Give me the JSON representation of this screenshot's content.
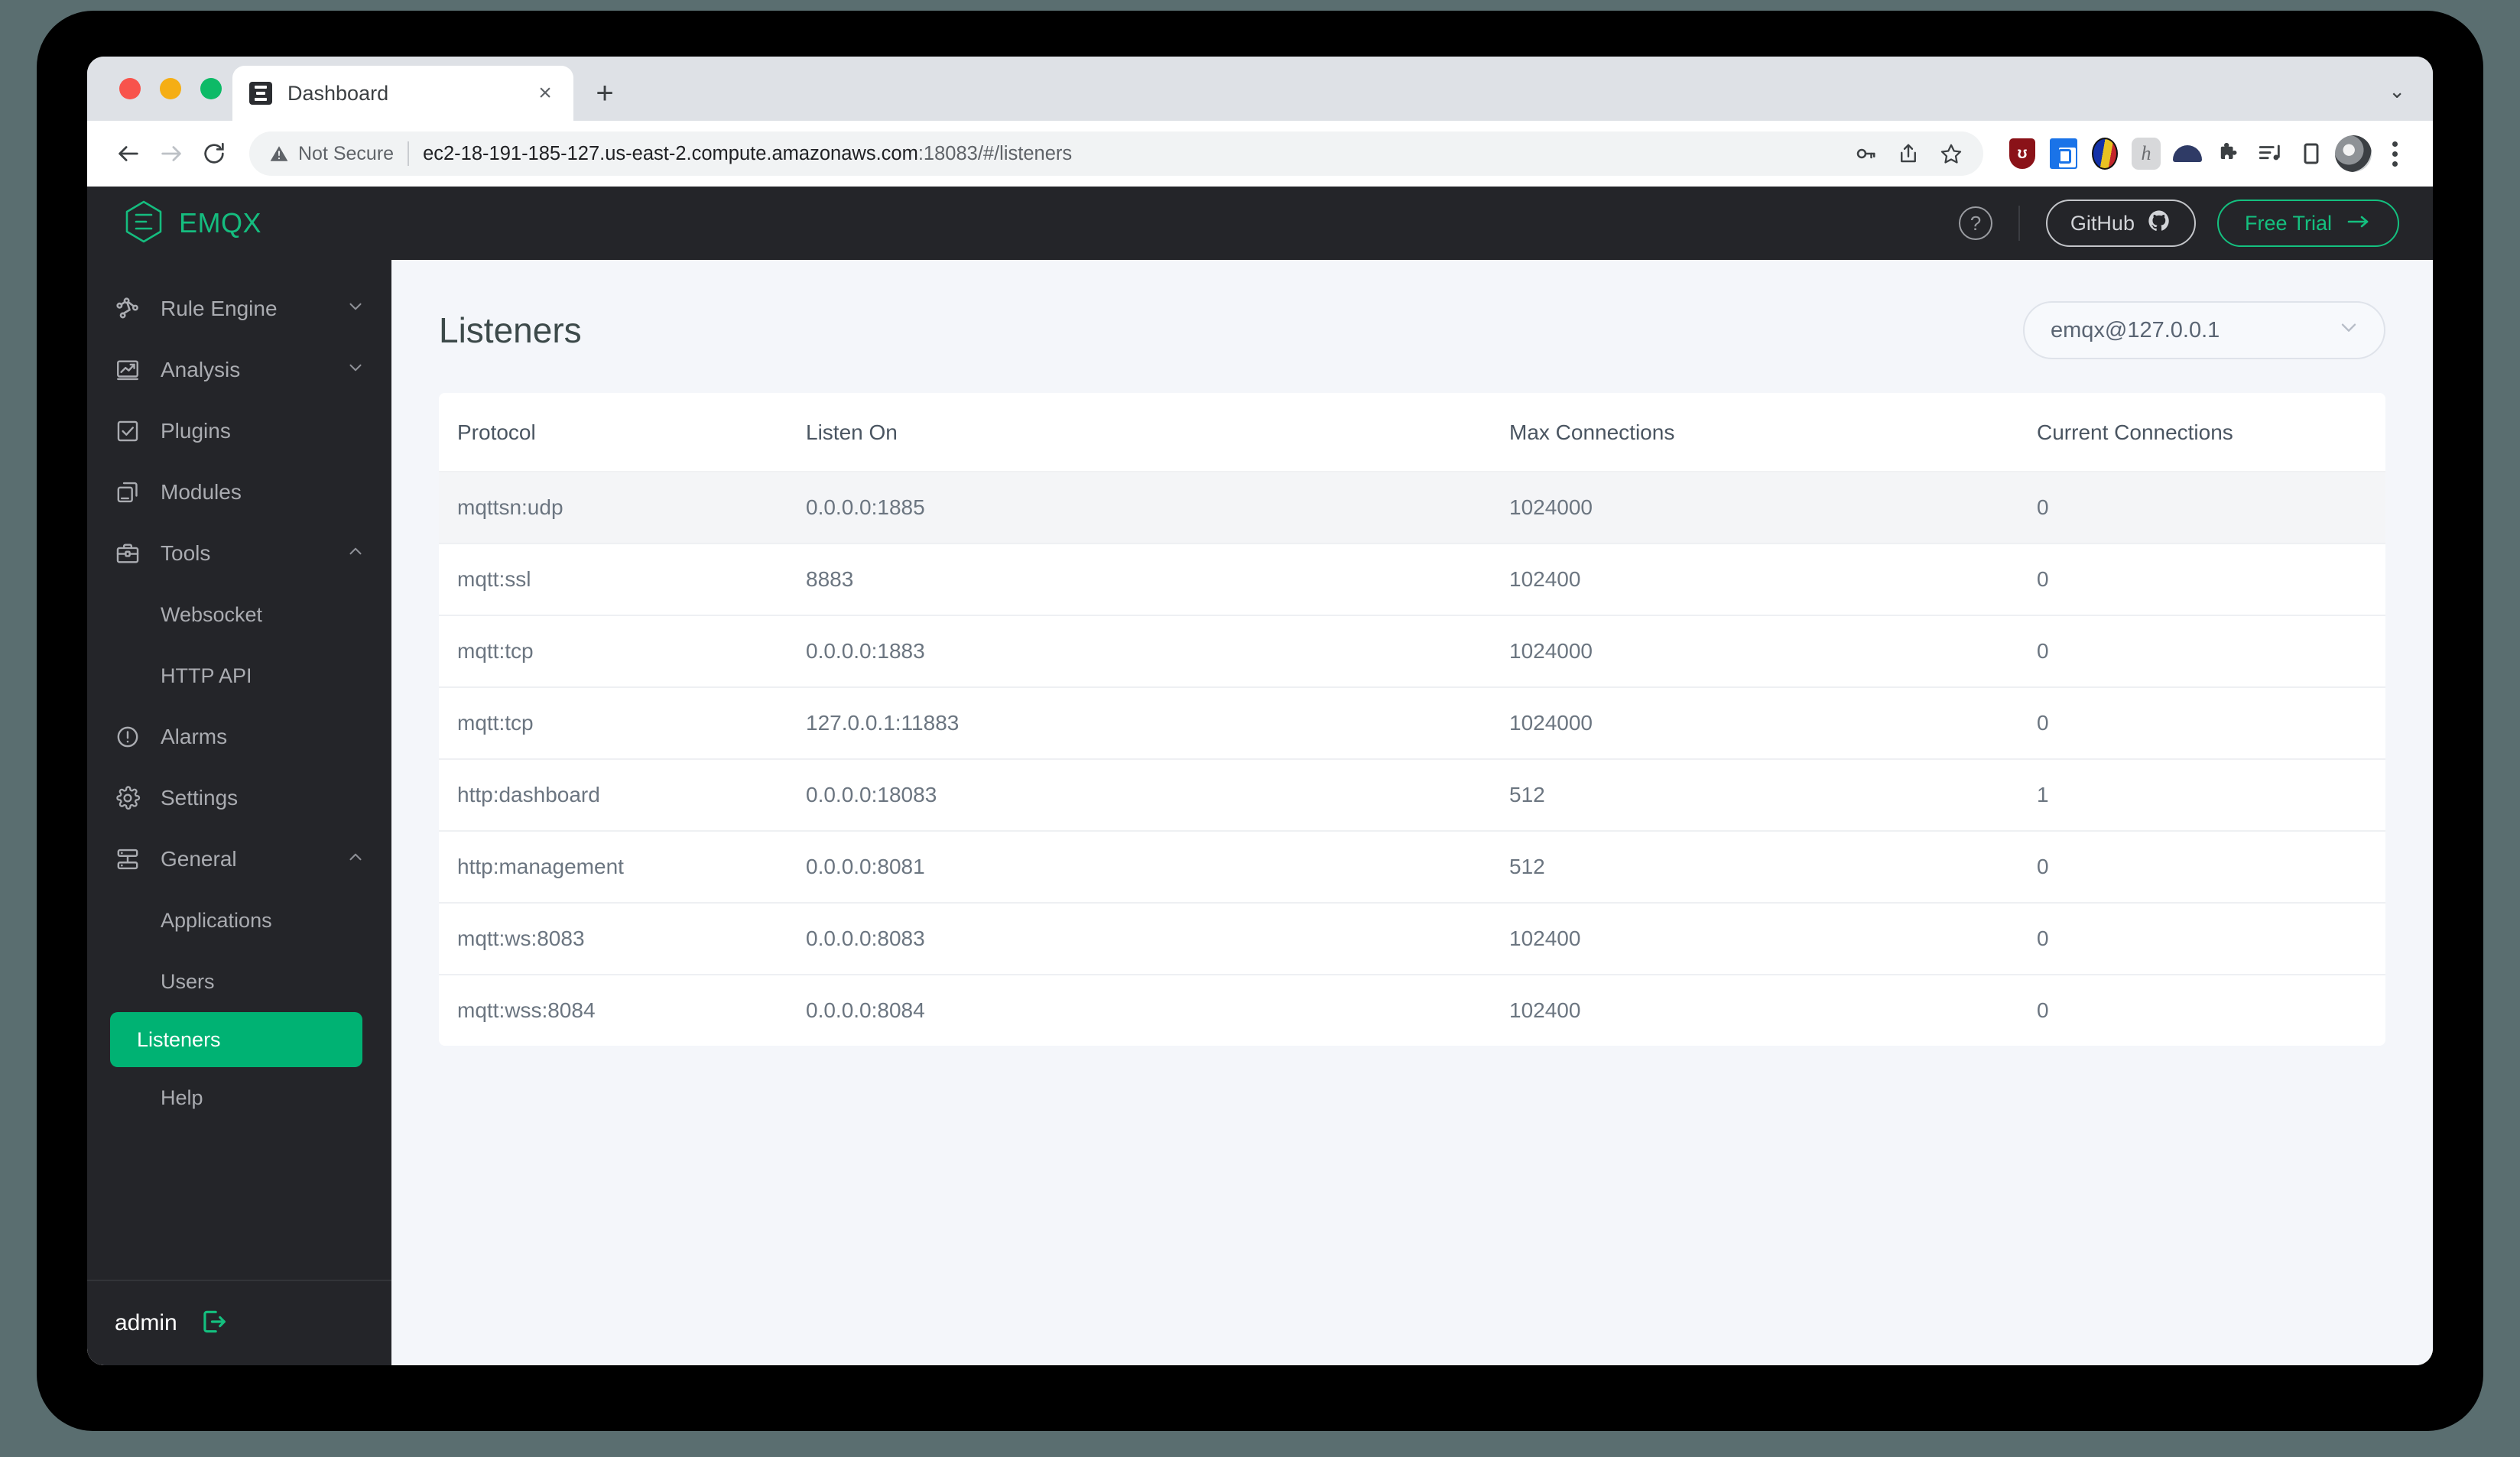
{
  "browser": {
    "tab_title": "Dashboard",
    "favicon_name": "emqx-favicon",
    "new_tab_label": "+",
    "close_tab_label": "×",
    "tab_list_label": "⌄",
    "security_label": "Not Secure",
    "url_domain": "ec2-18-191-185-127.us-east-2.compute.amazonaws.com",
    "url_tail": ":18083/#/listeners",
    "back_label": "←",
    "forward_label": "→",
    "reload_label": "↻"
  },
  "header": {
    "brand": "EMQX",
    "help_label": "?",
    "github_label": "GitHub",
    "free_trial_label": "Free Trial",
    "free_trial_arrow": "→",
    "accent_green": "#14c07f"
  },
  "sidebar": {
    "items": [
      {
        "label": "Rule Engine",
        "icon": "rule-engine-icon",
        "chevron": "down",
        "type": "group"
      },
      {
        "label": "Analysis",
        "icon": "analysis-icon",
        "chevron": "down",
        "type": "group"
      },
      {
        "label": "Plugins",
        "icon": "plugins-icon",
        "chevron": "none",
        "type": "item"
      },
      {
        "label": "Modules",
        "icon": "modules-icon",
        "chevron": "none",
        "type": "item"
      },
      {
        "label": "Tools",
        "icon": "tools-icon",
        "chevron": "up",
        "type": "group"
      },
      {
        "label": "Websocket",
        "icon": "none",
        "chevron": "none",
        "type": "sub"
      },
      {
        "label": "HTTP API",
        "icon": "none",
        "chevron": "none",
        "type": "sub"
      },
      {
        "label": "Alarms",
        "icon": "alarms-icon",
        "chevron": "none",
        "type": "item"
      },
      {
        "label": "Settings",
        "icon": "settings-icon",
        "chevron": "none",
        "type": "item"
      },
      {
        "label": "General",
        "icon": "general-icon",
        "chevron": "up",
        "type": "group"
      },
      {
        "label": "Applications",
        "icon": "none",
        "chevron": "none",
        "type": "sub"
      },
      {
        "label": "Users",
        "icon": "none",
        "chevron": "none",
        "type": "sub"
      },
      {
        "label": "Listeners",
        "icon": "none",
        "chevron": "none",
        "type": "sub",
        "active": true
      },
      {
        "label": "Help",
        "icon": "none",
        "chevron": "none",
        "type": "sub"
      }
    ],
    "active_color": "#00b273",
    "footer": {
      "user": "admin",
      "logout_icon": "logout-icon"
    }
  },
  "main": {
    "page_title": "Listeners",
    "node_selector": {
      "value": "emqx@127.0.0.1",
      "chevron": "chevron-down-icon"
    },
    "table": {
      "columns": [
        "Protocol",
        "Listen On",
        "Max Connections",
        "Current Connections"
      ],
      "rows": [
        {
          "protocol": "mqttsn:udp",
          "listen_on": "0.0.0.0:1885",
          "max_connections": "1024000",
          "current_connections": "0",
          "hovered": true
        },
        {
          "protocol": "mqtt:ssl",
          "listen_on": "8883",
          "max_connections": "102400",
          "current_connections": "0"
        },
        {
          "protocol": "mqtt:tcp",
          "listen_on": "0.0.0.0:1883",
          "max_connections": "1024000",
          "current_connections": "0"
        },
        {
          "protocol": "mqtt:tcp",
          "listen_on": "127.0.0.1:11883",
          "max_connections": "1024000",
          "current_connections": "0"
        },
        {
          "protocol": "http:dashboard",
          "listen_on": "0.0.0.0:18083",
          "max_connections": "512",
          "current_connections": "1"
        },
        {
          "protocol": "http:management",
          "listen_on": "0.0.0.0:8081",
          "max_connections": "512",
          "current_connections": "0"
        },
        {
          "protocol": "mqtt:ws:8083",
          "listen_on": "0.0.0.0:8083",
          "max_connections": "102400",
          "current_connections": "0"
        },
        {
          "protocol": "mqtt:wss:8084",
          "listen_on": "0.0.0.0:8084",
          "max_connections": "102400",
          "current_connections": "0"
        }
      ]
    }
  }
}
